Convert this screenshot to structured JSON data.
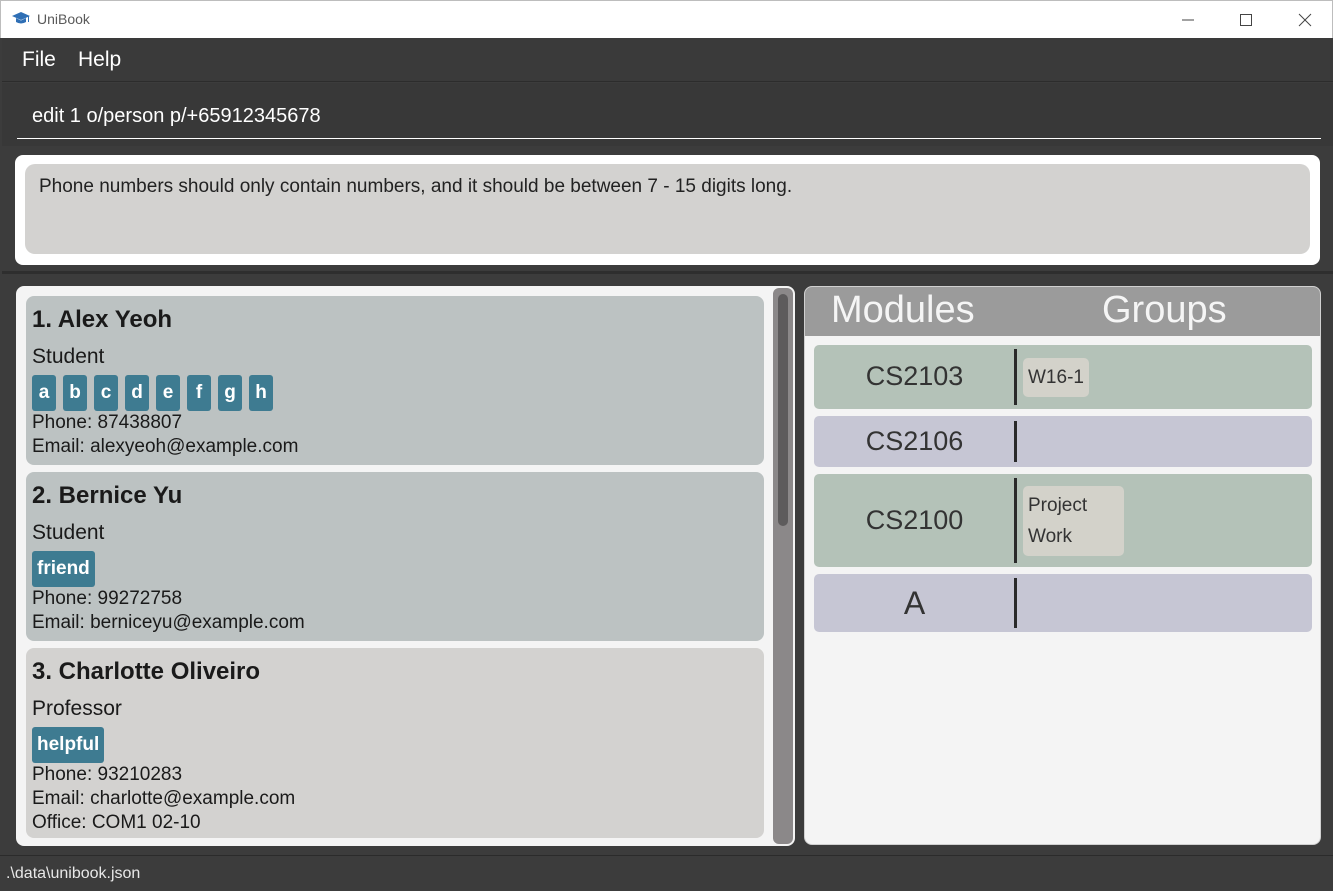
{
  "window": {
    "title": "UniBook",
    "icon": "graduation-cap-icon"
  },
  "menu": {
    "file": "File",
    "help": "Help"
  },
  "command": {
    "value": "edit 1 o/person p/+65912345678"
  },
  "result": {
    "message": "Phone numbers should only contain numbers, and it should be between 7 - 15 digits long."
  },
  "persons": [
    {
      "name": "1.  Alex Yeoh",
      "role": "Student",
      "tags": [
        "a",
        "b",
        "c",
        "d",
        "e",
        "f",
        "g",
        "h"
      ],
      "phone": "Phone: 87438807",
      "email": "Email: alexyeoh@example.com"
    },
    {
      "name": "2.  Bernice Yu",
      "role": "Student",
      "tags": [
        "friend"
      ],
      "phone": "Phone: 99272758",
      "email": "Email: berniceyu@example.com"
    },
    {
      "name": "3.  Charlotte Oliveiro",
      "role": "Professor",
      "tags": [
        "helpful"
      ],
      "phone": "Phone: 93210283",
      "email": "Email: charlotte@example.com",
      "office": "Office: COM1 02-10"
    }
  ],
  "modules_panel": {
    "modules_header": "Modules",
    "groups_header": "Groups",
    "rows": [
      {
        "code": "CS2103",
        "groups": [
          "W16-1"
        ],
        "color": "#b4c2b8"
      },
      {
        "code": "CS2106",
        "groups": [],
        "color": "#c6c6d4"
      },
      {
        "code": "CS2100",
        "groups": [
          "Project Work"
        ],
        "color": "#b4c2b8"
      },
      {
        "code": "A",
        "groups": [],
        "color": "#c6c6d4"
      }
    ]
  },
  "status": {
    "path": ".\\data\\unibook.json"
  },
  "colors": {
    "tag": "#3e7b91",
    "card_selected": "#bcc2c2",
    "card": "#d3d2d0",
    "background": "#3c3c3c"
  }
}
